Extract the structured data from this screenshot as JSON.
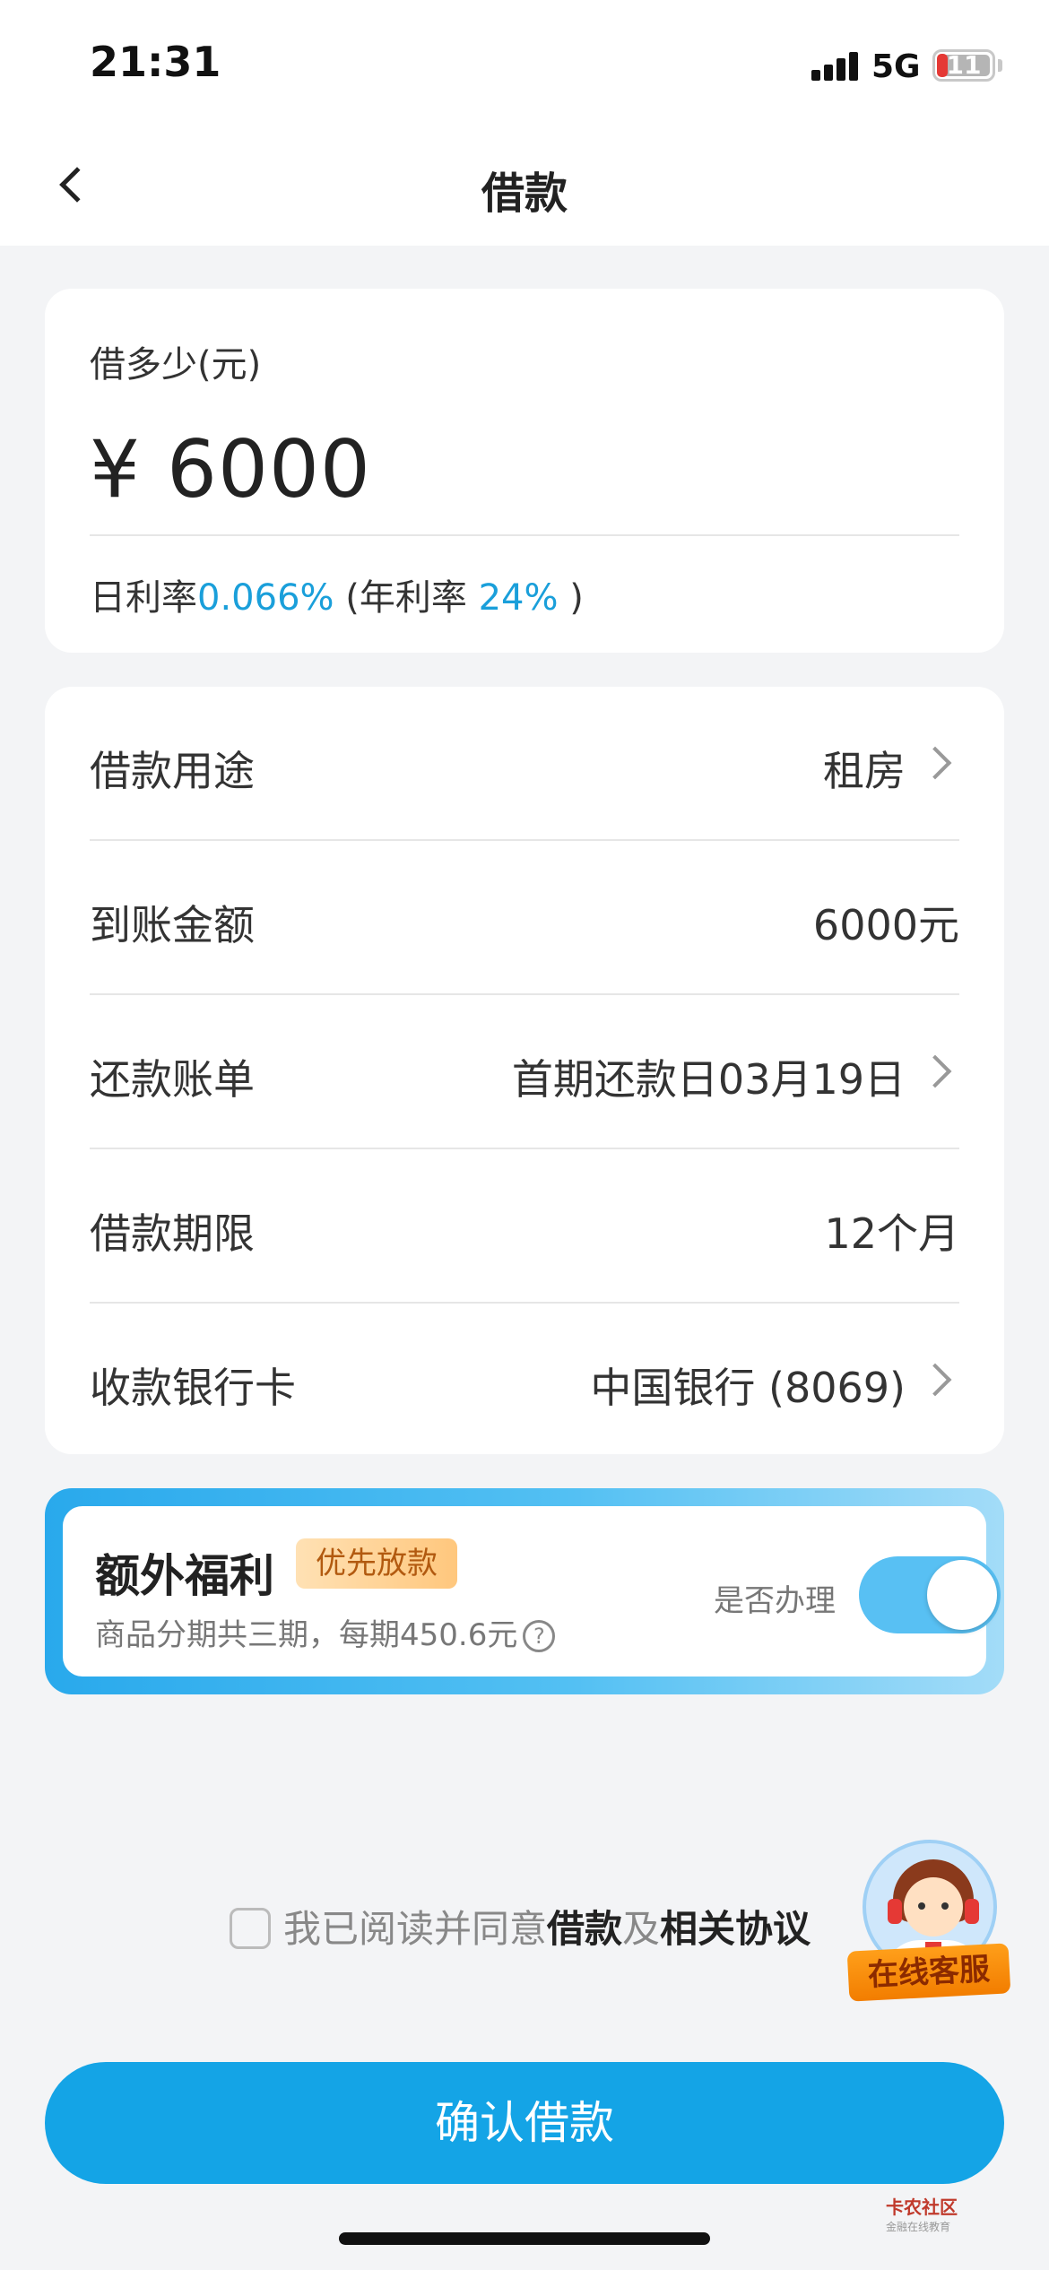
{
  "status_bar": {
    "time": "21:31",
    "network": "5G",
    "battery": "11"
  },
  "nav": {
    "title": "借款"
  },
  "amount": {
    "label": "借多少(元)",
    "value": "¥ 6000",
    "rate_prefix": "日利率",
    "daily_rate": "0.066%",
    "annual_prefix": " (年利率 ",
    "annual_rate": "24%",
    "annual_suffix": " )"
  },
  "details": {
    "purpose": {
      "label": "借款用途",
      "value": "租房"
    },
    "received": {
      "label": "到账金额",
      "value": "6000元"
    },
    "bill": {
      "label": "还款账单",
      "value": "首期还款日03月19日"
    },
    "term": {
      "label": "借款期限",
      "value": "12个月"
    },
    "card": {
      "label": "收款银行卡",
      "value": "中国银行 (8069)"
    }
  },
  "benefit": {
    "title": "额外福利",
    "tag": "优先放款",
    "subtitle": "商品分期共三期，每期450.6元",
    "help": "?",
    "toggle_label": "是否办理",
    "toggle_on": true
  },
  "agreement": {
    "prefix": "我已阅读并同意",
    "link1": "借款",
    "middle": "及",
    "link2": "相关协议",
    "checked": false
  },
  "customer_service": {
    "label": "在线客服"
  },
  "confirm": {
    "label": "确认借款"
  },
  "watermark": {
    "title": "卡农社区",
    "subtitle": "金融在线教育"
  },
  "colors": {
    "accent": "#14a4e6",
    "link_blue": "#1a9fda",
    "tag_bg": "#ffc77d"
  }
}
